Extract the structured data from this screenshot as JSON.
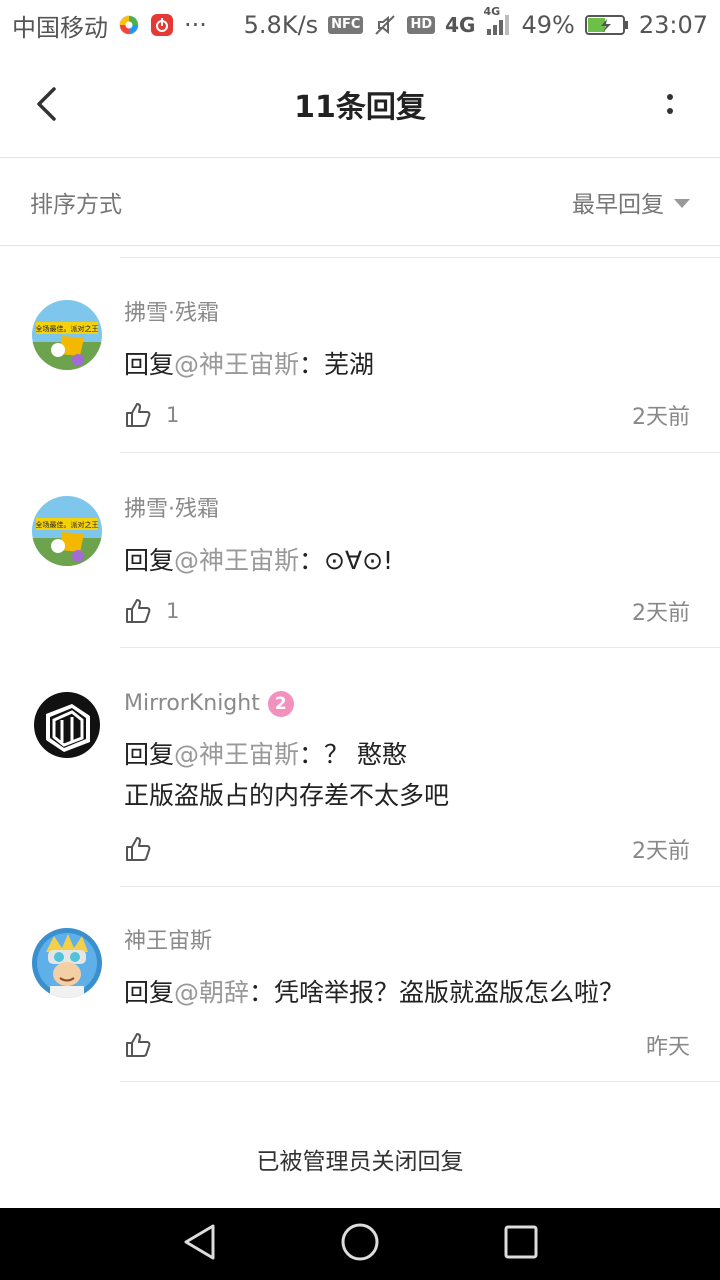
{
  "status_bar": {
    "carrier": "中国移动",
    "more": "···",
    "speed": "5.8K/s",
    "nfc": "NFC",
    "hd": "HD",
    "network": "4G",
    "network2": "4G",
    "battery": "49%",
    "time": "23:07"
  },
  "header": {
    "title": "11条回复"
  },
  "sort": {
    "label": "排序方式",
    "value": "最早回复"
  },
  "replies": [
    {
      "user": "拂雪·残霜",
      "prefix": "回复",
      "mention": "@神王宙斯",
      "text": "：芜湖",
      "text2": "",
      "likes": "1",
      "time": "2天前",
      "avatar_banner": "全场最佳。派对之王"
    },
    {
      "user": "拂雪·残霜",
      "prefix": "回复",
      "mention": "@神王宙斯",
      "text": "：⊙∀⊙!",
      "text2": "",
      "likes": "1",
      "time": "2天前",
      "avatar_banner": "全场最佳。派对之王"
    },
    {
      "user": "MirrorKnight",
      "level": "2",
      "prefix": "回复",
      "mention": "@神王宙斯",
      "text": "：？ 憨憨",
      "text2": "正版盗版占的内存差不太多吧",
      "likes": "",
      "time": "2天前"
    },
    {
      "user": "神王宙斯",
      "prefix": "回复",
      "mention": "@朝辞",
      "text": "：凭啥举报？盗版就盗版怎么啦？",
      "text2": "",
      "likes": "",
      "time": "昨天"
    }
  ],
  "footer_notice": "已被管理员关闭回复",
  "colors": {
    "accent_level": "#f291bd",
    "text_primary": "#222222",
    "text_secondary": "#8a8a8a",
    "navbar": "#000000"
  }
}
